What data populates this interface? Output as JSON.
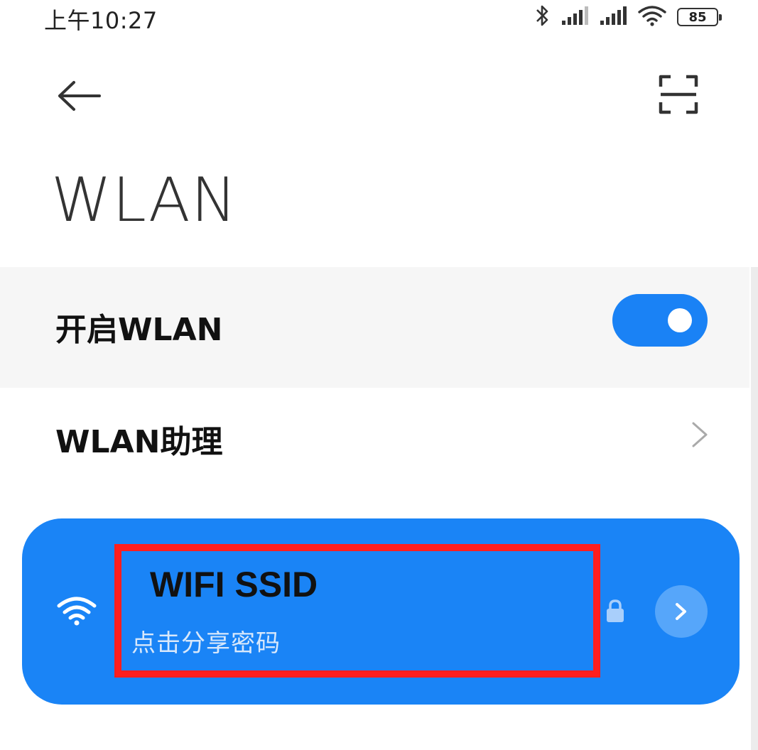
{
  "status_bar": {
    "time": "上午10:27",
    "battery_level": "85",
    "icons": [
      "bluetooth-icon",
      "signal-icon",
      "signal-icon",
      "wifi-icon",
      "battery-icon"
    ]
  },
  "header": {
    "back_icon": "arrow-left-icon",
    "scan_icon": "scan-icon",
    "title": "WLAN"
  },
  "settings": {
    "wlan_toggle_label": "开启WLAN",
    "wlan_toggle_on": true,
    "assistant_label": "WLAN助理"
  },
  "network": {
    "ssid": "WIFI SSID",
    "subtitle": "点击分享密码",
    "secured": true
  },
  "colors": {
    "accent": "#1a84f6",
    "highlight_border": "#ff1e1e",
    "row_background": "#f6f6f6"
  }
}
